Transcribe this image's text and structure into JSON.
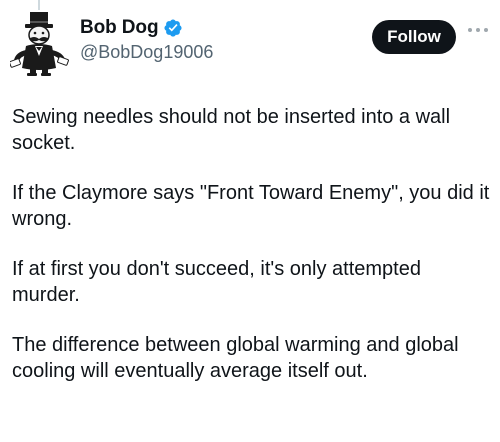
{
  "author": {
    "display_name": "Bob Dog",
    "handle": "@BobDog19006",
    "verified_icon": "verified-badge-icon",
    "avatar_icon": "monopoly-man-avatar"
  },
  "actions": {
    "follow_label": "Follow",
    "more_icon": "more-options-icon"
  },
  "tweet": {
    "paragraphs": [
      "Sewing needles should not be inserted into a wall socket.",
      "If the Claymore says \"Front Toward Enemy\", you did it wrong.",
      "If at first you don't succeed, it's only attempted murder.",
      "The difference between global warming and global cooling will eventually average itself out."
    ]
  },
  "colors": {
    "text": "#0f1419",
    "secondary_text": "#536471",
    "verified": "#1d9bf0",
    "button_bg": "#0f1419",
    "button_text": "#ffffff"
  }
}
